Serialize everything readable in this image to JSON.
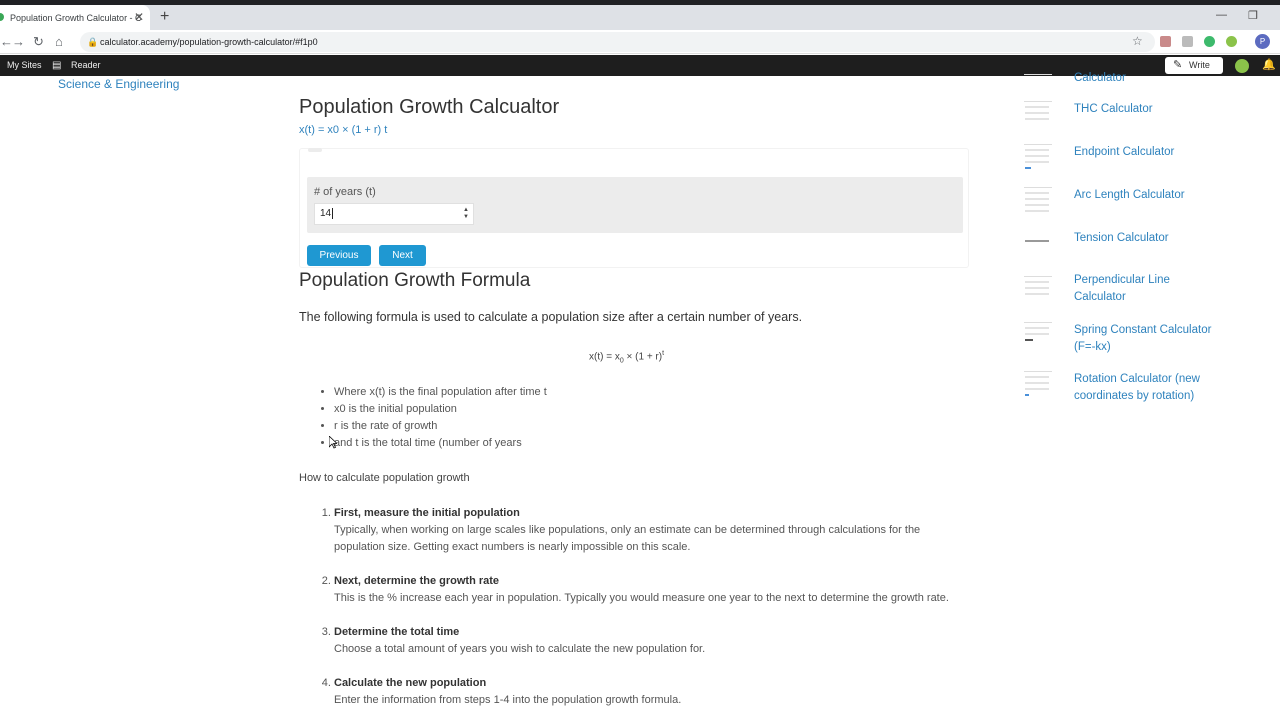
{
  "browser": {
    "tab_title": "Population Growth Calculator - C",
    "url": "calculator.academy/population-growth-calculator/#f1p0",
    "profile_initial": "P"
  },
  "wp_bar": {
    "my_sites": "My Sites",
    "reader": "Reader",
    "write": "Write"
  },
  "left_link": "Science & Engineering",
  "calc": {
    "title": "Population Growth Calcualtor",
    "formula_link": "x(t) = x0 × (1 + r) t",
    "field_label": "# of years (t)",
    "field_value": "14",
    "prev_label": "Previous",
    "next_label": "Next"
  },
  "article": {
    "heading": "Population Growth Formula",
    "intro": "The following formula is used to calculate a population size after a certain number of years.",
    "eq_main": "x(t) = x",
    "eq_sub": "0",
    "eq_tail": " × (1 + r)",
    "eq_sup": "t",
    "defs": [
      "Where x(t) is the final population after time t",
      "x0 is the initial population",
      "r is the rate of growth",
      "and t is the total time (number of years"
    ],
    "how": "How to calculate population growth",
    "steps": [
      {
        "title": "First, measure the initial population",
        "body": "Typically, when working on large scales like populations, only an estimate can be determined through calculations for the population size. Getting exact numbers is nearly impossible on this scale."
      },
      {
        "title": "Next, determine the growth rate",
        "body": "This is the % increase each year in population. Typically you would measure one year to the next to determine the growth rate."
      },
      {
        "title": "Determine the total time",
        "body": "Choose a total amount of years you wish to calculate the new population for."
      },
      {
        "title": "Calculate the new population",
        "body": "Enter the information from steps 1-4 into the population growth formula."
      }
    ]
  },
  "sidebar": {
    "items": [
      {
        "label": "Calculator"
      },
      {
        "label": "THC Calculator"
      },
      {
        "label": "Endpoint Calculator"
      },
      {
        "label": "Arc Length Calculator"
      },
      {
        "label": "Tension Calculator"
      },
      {
        "label": "Perpendicular Line Calculator"
      },
      {
        "label": "Spring Constant Calculator (F=-kx)"
      },
      {
        "label": "Rotation Calculator (new coordinates by rotation)"
      }
    ]
  }
}
